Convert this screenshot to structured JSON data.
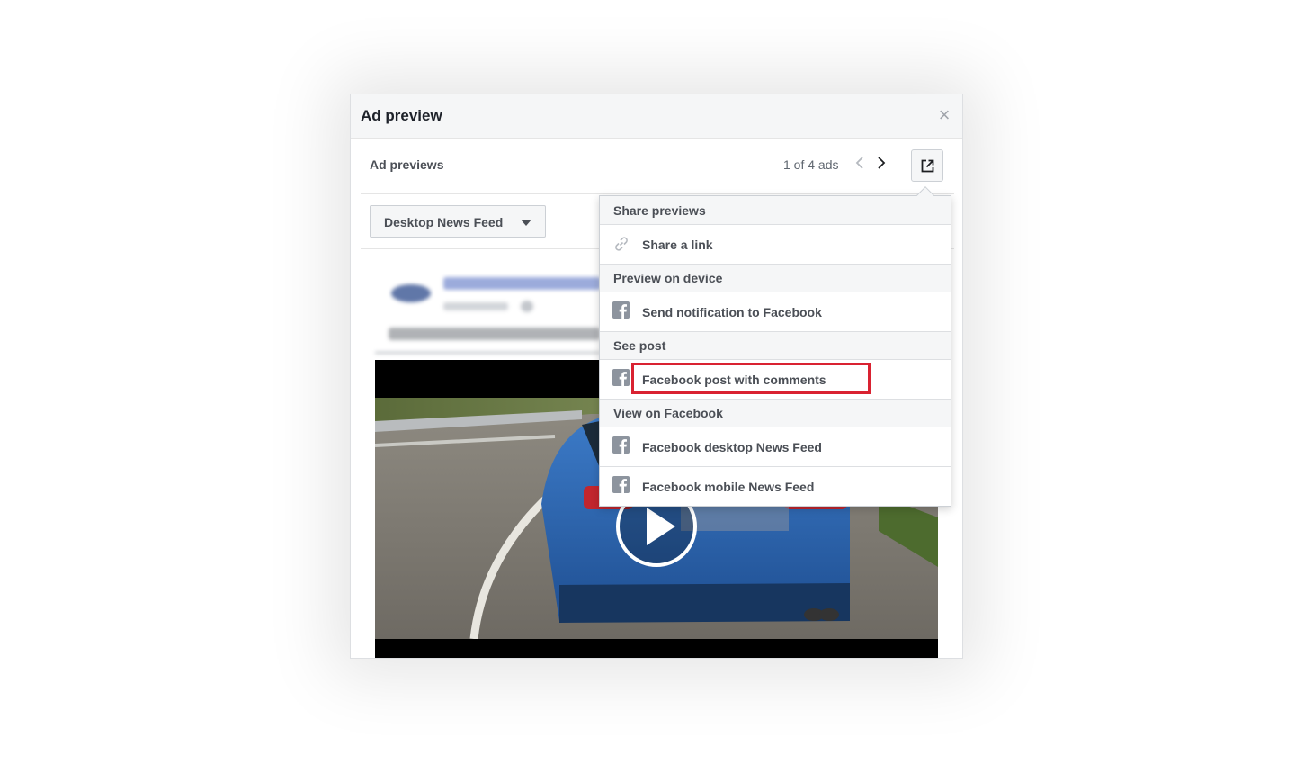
{
  "dialog": {
    "title": "Ad preview",
    "close_icon": "close-icon"
  },
  "subheader": {
    "label": "Ad previews",
    "ad_count": "1 of 4 ads",
    "prev_icon": "chevron-left-icon",
    "next_icon": "chevron-right-icon",
    "share_icon": "external-share-icon"
  },
  "placement": {
    "selected": "Desktop News Feed"
  },
  "menu": {
    "sections": [
      {
        "title": "Share previews",
        "items": [
          {
            "label": "Share a link",
            "icon": "link-icon"
          }
        ]
      },
      {
        "title": "Preview on device",
        "items": [
          {
            "label": "Send notification to Facebook",
            "icon": "facebook-icon"
          }
        ]
      },
      {
        "title": "See post",
        "items": [
          {
            "label": "Facebook post with comments",
            "icon": "facebook-icon",
            "highlighted": true
          }
        ]
      },
      {
        "title": "View on Facebook",
        "items": [
          {
            "label": "Facebook desktop News Feed",
            "icon": "facebook-icon"
          },
          {
            "label": "Facebook mobile News Feed",
            "icon": "facebook-icon"
          }
        ]
      }
    ]
  },
  "colors": {
    "highlight": "#d92231",
    "car_blue": "#2f6bb8",
    "header_bg": "#f5f6f7"
  }
}
